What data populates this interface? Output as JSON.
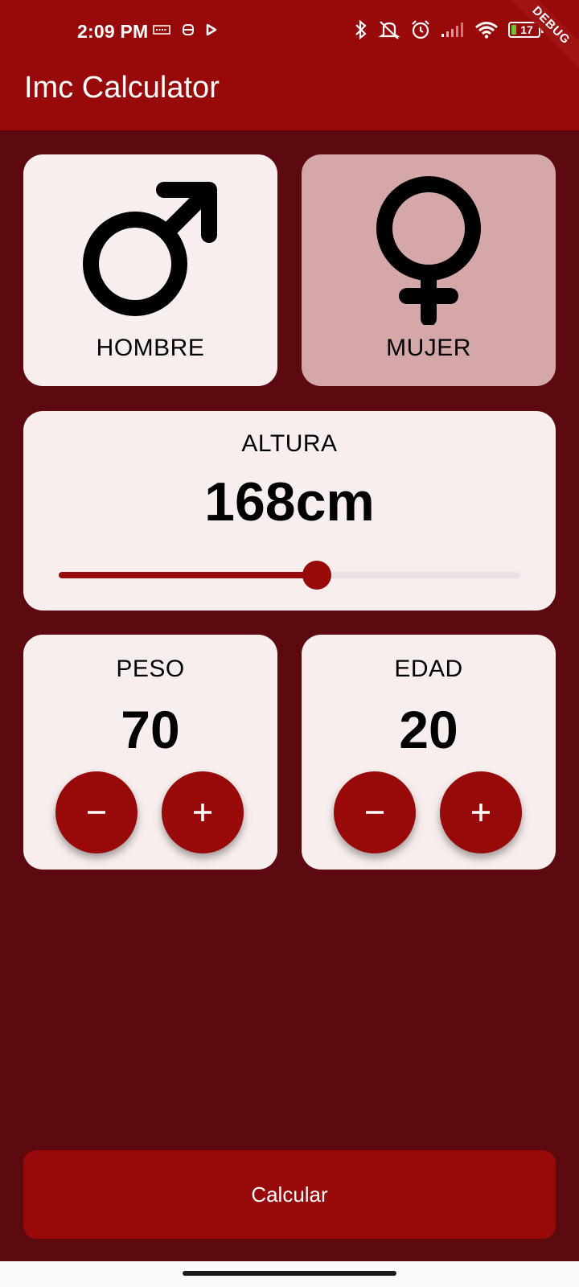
{
  "status_bar": {
    "time": "2:09 PM",
    "left_icons": [
      "keyboard-icon",
      "robot-icon",
      "play-icon"
    ],
    "right_icons": [
      "bluetooth-icon",
      "mute-icon",
      "alarm-icon",
      "signal-icon",
      "wifi-icon"
    ],
    "battery_level": "17",
    "battery_color": "#6ac33a"
  },
  "debug_banner": "DEBUG",
  "app_bar": {
    "title": "Imc Calculator"
  },
  "gender": {
    "male": {
      "label": "HOMBRE",
      "icon": "male-icon",
      "selected": true
    },
    "female": {
      "label": "MUJER",
      "icon": "female-icon",
      "selected": false
    }
  },
  "height": {
    "label": "ALTURA",
    "value_text": "168cm",
    "slider_fraction": 0.56
  },
  "weight": {
    "label": "PESO",
    "value": "70"
  },
  "age": {
    "label": "EDAD",
    "value": "20"
  },
  "calculate_button": {
    "label": "Calcular"
  },
  "colors": {
    "accent": "#980a0a",
    "background": "#5c0a10",
    "card": "#f8eeed",
    "card_unselected": "#d4a7a8"
  }
}
